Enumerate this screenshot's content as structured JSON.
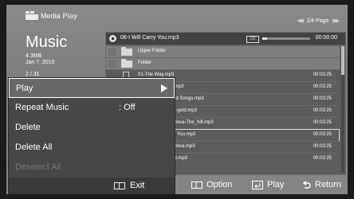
{
  "header": {
    "brand_main": "Media",
    "brand_sub": "Play"
  },
  "sidebar": {
    "title": "Music",
    "size": "4.3MB",
    "date": "Jan 7, 2010",
    "counter": "2 / 31"
  },
  "page_nav": {
    "prev": "◀◀",
    "label": "1/4 Page",
    "next": "▶▶"
  },
  "now_playing": {
    "title": "06-I Will Carry You.mp3",
    "badge": "CD",
    "time": "00:00:00",
    "progress": 0.1
  },
  "files": [
    {
      "name": "Upper Folder",
      "type": "folder",
      "duration": ""
    },
    {
      "name": "Folder",
      "type": "folder",
      "duration": ""
    },
    {
      "name": "01-The Way.mp3",
      "type": "file",
      "duration": "00:03:25"
    },
    {
      "name": ".mp3",
      "type": "file",
      "duration": "00:03:25"
    },
    {
      "name": "ad Songs.mp3",
      "type": "file",
      "duration": "00:03:25"
    },
    {
      "name": "a-gold.mp3",
      "type": "file",
      "duration": "00:03:25"
    },
    {
      "name": "glova-The_hill.mp3",
      "type": "file",
      "duration": "00:03:25"
    },
    {
      "name": "u You.mp3",
      "type": "file",
      "duration": "00:03:25"
    },
    {
      "name": "glova.mp3",
      "type": "file",
      "duration": "00:03:25"
    },
    {
      "name": "ld.mp3",
      "type": "file",
      "duration": "00:03:25"
    }
  ],
  "menu": {
    "items": [
      {
        "label": "Play",
        "value": "",
        "state": "selected"
      },
      {
        "label": "Repeat Music",
        "value": ": Off",
        "state": "normal"
      },
      {
        "label": "Delete",
        "value": "",
        "state": "normal"
      },
      {
        "label": "Delete All",
        "value": "",
        "state": "normal"
      },
      {
        "label": "Deselect All",
        "value": "",
        "state": "disabled"
      }
    ],
    "exit_label": "Exit"
  },
  "legend": {
    "option": "Option",
    "play": "Play",
    "return": "Return"
  },
  "icons": {
    "brand": "media-play-icon",
    "folder": "folder-icon",
    "file": "music-file-icon",
    "exit": "exit-remote-icon",
    "option": "tools-remote-icon",
    "play": "enter-icon",
    "return": "return-arrow-icon"
  }
}
